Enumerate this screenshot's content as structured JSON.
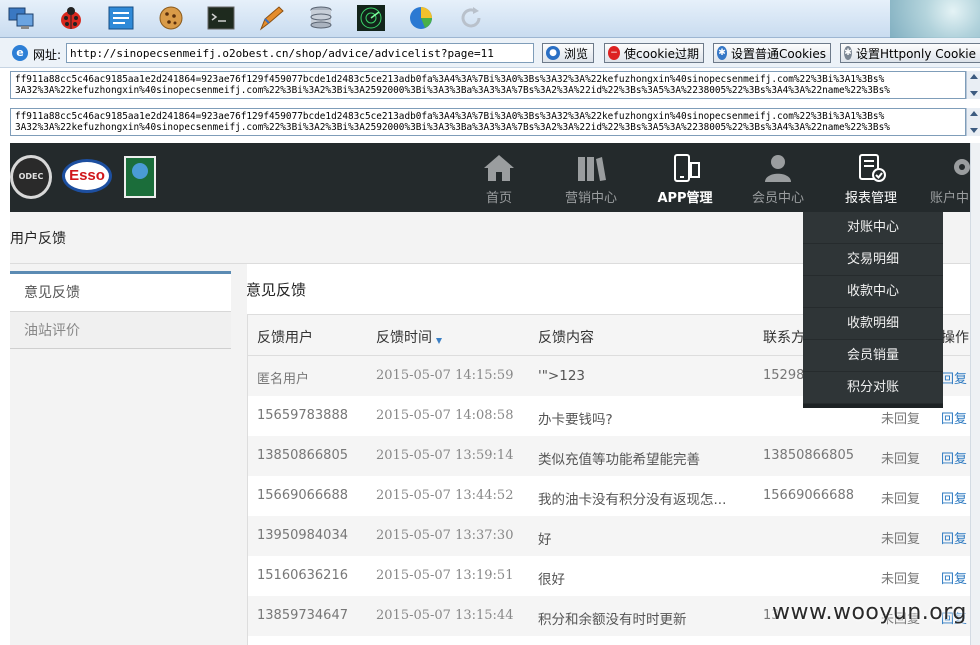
{
  "toolbar_icons": [
    "computer-icon",
    "ladybug-icon",
    "window-icon",
    "cookie-icon",
    "terminal-icon",
    "pen-icon",
    "database-icon",
    "radar-icon",
    "pie-chart-icon",
    "refresh-icon"
  ],
  "address": {
    "label": "网址:",
    "url": "http://sinopecsenmeifj.o2obest.cn/shop/advice/advicelist?page=11"
  },
  "buttons": {
    "browse": "浏览",
    "expire_cookie": "使cookie过期",
    "set_cookie": "设置普通Cookies",
    "set_httponly": "设置Httponly Cookie"
  },
  "cookie1": "ff911a88cc5c46ac9185aa1e2d241864=923ae76f129f459077bcde1d2483c5ce213adb0fa%3A4%3A%7Bi%3A0%3Bs%3A32%3A%22kefuzhongxin%40sinopecsenmeifj.com%22%3Bi%3A1%3Bs%\n3A32%3A%22kefuzhongxin%40sinopecsenmeifj.com%22%3Bi%3A2%3Bi%3A2592000%3Bi%3A3%3Ba%3A3%3A%7Bs%3A2%3A%22id%22%3Bs%3A5%3A%2238005%22%3Bs%3A4%3A%22name%22%3Bs%",
  "cookie2": "ff911a88cc5c46ac9185aa1e2d241864=923ae76f129f459077bcde1d2483c5ce213adb0fa%3A4%3A%7Bi%3A0%3Bs%3A32%3A%22kefuzhongxin%40sinopecsenmeifj.com%22%3Bi%3A1%3Bs%\n3A32%3A%22kefuzhongxin%40sinopecsenmeifj.com%22%3Bi%3A2%3Bi%3A2592000%3Bi%3A3%3Ba%3A3%3A%7Bs%3A2%3A%22id%22%3Bs%3A5%3A%2238005%22%3Bs%3A4%3A%22name%22%3Bs%",
  "logos": {
    "sinopec": "ODEC",
    "esso": "Esso"
  },
  "nav": [
    {
      "label": "首页",
      "icon": "home-icon"
    },
    {
      "label": "营销中心",
      "icon": "books-icon"
    },
    {
      "label": "APP管理",
      "icon": "mobile-icon"
    },
    {
      "label": "会员中心",
      "icon": "user-icon"
    },
    {
      "label": "报表管理",
      "icon": "report-icon"
    },
    {
      "label": "账户中",
      "icon": "gear-icon"
    }
  ],
  "breadcrumb": "用户反馈",
  "sidebar": {
    "items": [
      "意见反馈",
      "油站评价"
    ]
  },
  "main": {
    "title": "意见反馈",
    "columns": [
      "反馈用户",
      "反馈时间",
      "反馈内容",
      "联系方",
      "操作"
    ],
    "rows": [
      {
        "user": "匿名用户",
        "time": "2015-05-07 14:15:59",
        "content": "'\">123",
        "contact": "15298",
        "status": "",
        "op": "回复"
      },
      {
        "user": "15659783888",
        "time": "2015-05-07 14:08:58",
        "content": "办卡要钱吗?",
        "contact": "",
        "status": "未回复",
        "op": "回复"
      },
      {
        "user": "13850866805",
        "time": "2015-05-07 13:59:14",
        "content": "类似充值等功能希望能完善",
        "contact": "13850866805",
        "status": "未回复",
        "op": "回复"
      },
      {
        "user": "15669066688",
        "time": "2015-05-07 13:44:52",
        "content": "我的油卡没有积分没有返现怎...",
        "contact": "15669066688",
        "status": "未回复",
        "op": "回复"
      },
      {
        "user": "13950984034",
        "time": "2015-05-07 13:37:30",
        "content": "好",
        "contact": "",
        "status": "未回复",
        "op": "回复"
      },
      {
        "user": "15160636216",
        "time": "2015-05-07 13:19:51",
        "content": "很好",
        "contact": "",
        "status": "未回复",
        "op": "回复"
      },
      {
        "user": "13859734647",
        "time": "2015-05-07 13:15:44",
        "content": "积分和余额没有时时更新",
        "contact": "13",
        "status": "未回复",
        "op": "回复"
      }
    ]
  },
  "dropdown": [
    "对账中心",
    "交易明细",
    "收款中心",
    "收款明细",
    "会员销量",
    "积分对账"
  ],
  "watermark": "www.wooyun.org"
}
